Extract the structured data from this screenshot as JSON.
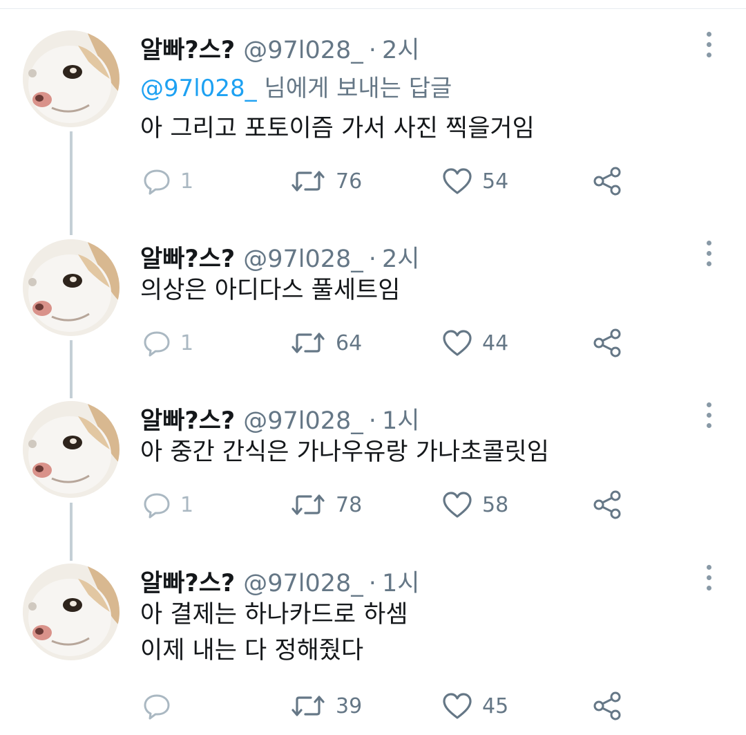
{
  "tweets": [
    {
      "name": "알빠?스?",
      "handle": "@97l028_",
      "separator": "·",
      "time": "2시",
      "reply_mention": "@97l028_",
      "reply_suffix": "님에게 보내는 답글",
      "lines": [
        "아 그리고 포토이즘 가서 사진 찍을거임"
      ],
      "replies": "1",
      "retweets": "76",
      "likes": "54"
    },
    {
      "name": "알빠?스?",
      "handle": "@97l028_",
      "separator": "·",
      "time": "2시",
      "lines": [
        "의상은 아디다스 풀세트임"
      ],
      "replies": "1",
      "retweets": "64",
      "likes": "44"
    },
    {
      "name": "알빠?스?",
      "handle": "@97l028_",
      "separator": "·",
      "time": "1시",
      "lines": [
        "아 중간 간식은 가나우유랑 가나초콜릿임"
      ],
      "replies": "1",
      "retweets": "78",
      "likes": "58"
    },
    {
      "name": "알빠?스?",
      "handle": "@97l028_",
      "separator": "·",
      "time": "1시",
      "lines": [
        "아 결제는 하나카드로 하셈",
        "이제 내는 다 정해줬다"
      ],
      "replies": "",
      "retweets": "39",
      "likes": "45"
    }
  ],
  "icons": {
    "reply": "reply-icon",
    "retweet": "retweet-icon",
    "like": "heart-icon",
    "share": "share-icon",
    "more": "more-vertical-icon"
  },
  "colors": {
    "mention": "#1da1f2",
    "secondary_text": "#657786",
    "thread_line": "#c4cfd6"
  }
}
